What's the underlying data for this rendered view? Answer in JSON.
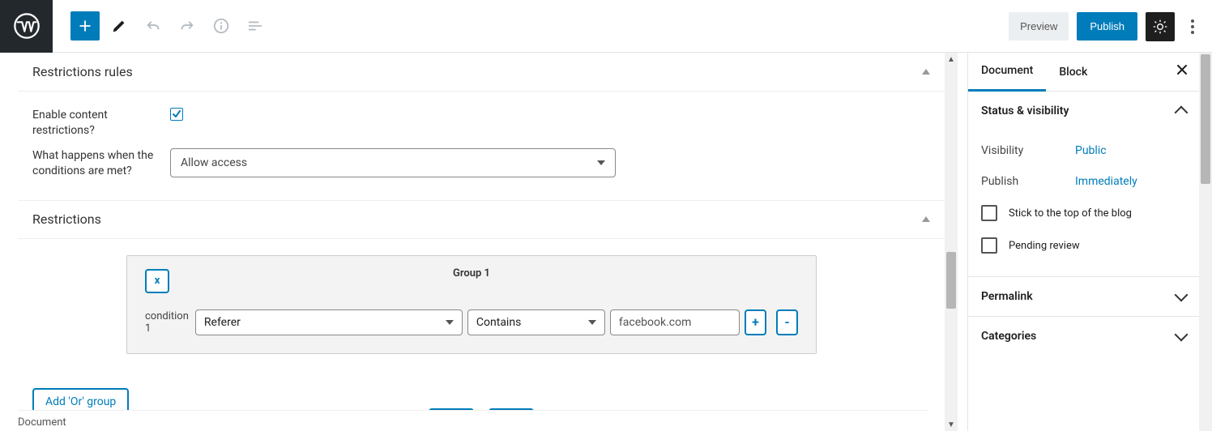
{
  "topbar": {
    "preview_label": "Preview",
    "publish_label": "Publish"
  },
  "panels": {
    "rules_title": "Restrictions rules",
    "restrictions_title": "Restrictions"
  },
  "rules": {
    "enable_label": "Enable content restrictions?",
    "enable_checked": true,
    "action_label": "What happens when the conditions are met?",
    "action_value": "Allow access"
  },
  "group": {
    "title": "Group 1",
    "close_symbol": "x",
    "condition_label": "condition 1",
    "field_value": "Referer",
    "operator_value": "Contains",
    "input_value": "facebook.com",
    "plus_symbol": "+",
    "minus_symbol": "-"
  },
  "add_or_label": "Add 'Or' group",
  "partial_buttons": {
    "a": "",
    "b": ""
  },
  "sidebar": {
    "tabs": {
      "document": "Document",
      "block": "Block"
    },
    "status_title": "Status & visibility",
    "visibility_label": "Visibility",
    "visibility_value": "Public",
    "publish_label": "Publish",
    "publish_value": "Immediately",
    "sticky_label": "Stick to the top of the blog",
    "pending_label": "Pending review",
    "permalink_title": "Permalink",
    "categories_title": "Categories"
  },
  "breadcrumb": "Document"
}
